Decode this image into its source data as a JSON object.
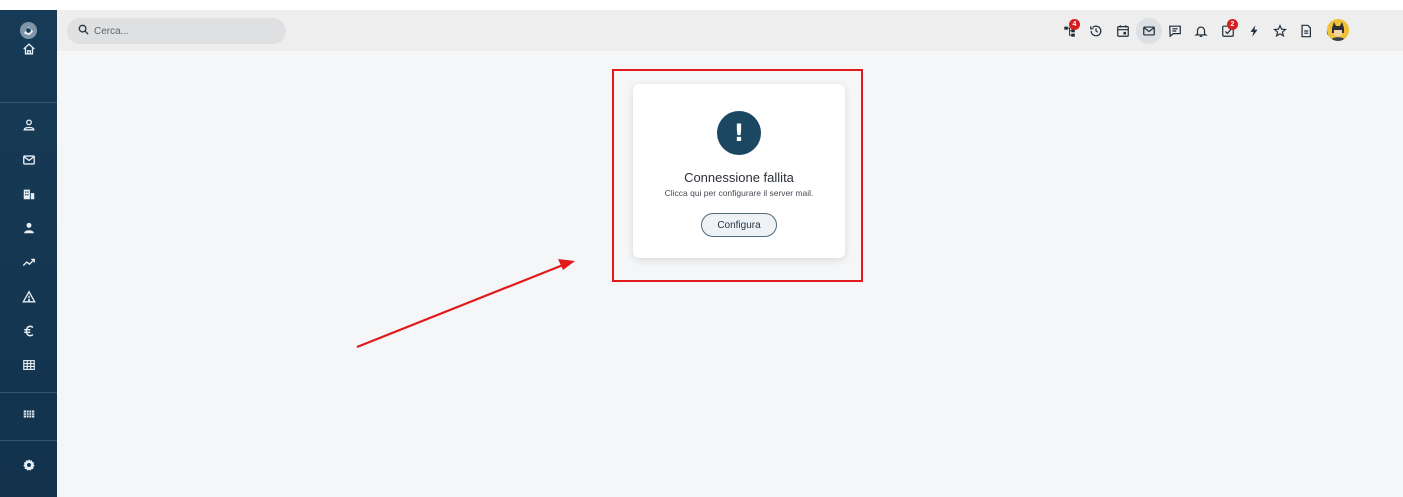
{
  "search": {
    "placeholder": "Cerca..."
  },
  "topbar": {
    "icons": [
      {
        "name": "workflow-icon",
        "badge": "4"
      },
      {
        "name": "history-icon"
      },
      {
        "name": "calendar-icon"
      },
      {
        "name": "mail-icon",
        "active": true
      },
      {
        "name": "chat-icon"
      },
      {
        "name": "bell-icon"
      },
      {
        "name": "tasks-icon",
        "badge": "2"
      },
      {
        "name": "lightning-icon"
      },
      {
        "name": "star-icon"
      },
      {
        "name": "document-icon"
      },
      {
        "name": "timer-icon"
      }
    ],
    "avatar": "avatar"
  },
  "sidebar": {
    "items": [
      {
        "name": "home-icon"
      },
      {
        "name": "contacts-icon"
      },
      {
        "name": "mail-icon"
      },
      {
        "name": "building-icon"
      },
      {
        "name": "user-icon"
      },
      {
        "name": "trend-icon"
      },
      {
        "name": "warning-icon"
      },
      {
        "name": "euro-icon"
      },
      {
        "name": "table-icon"
      },
      {
        "name": "grid-icon"
      },
      {
        "name": "settings-icon"
      }
    ]
  },
  "card": {
    "icon_glyph": "!",
    "title": "Connessione fallita",
    "subtitle": "Clicca qui per configurare il server mail.",
    "button_label": "Configura"
  },
  "colors": {
    "sidebar": "#173b57",
    "accent": "#1b4763",
    "badge": "#d3201f",
    "highlight": "#e11b1b"
  }
}
